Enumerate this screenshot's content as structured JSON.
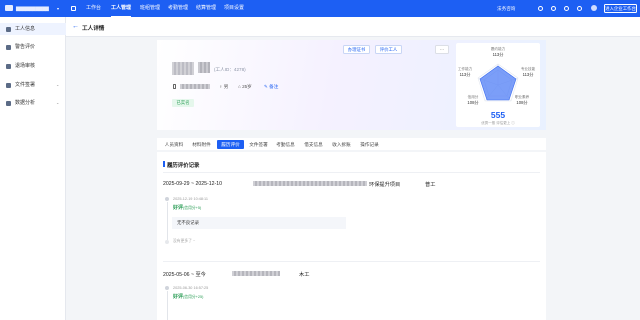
{
  "topbar": {
    "company_dropdown": "▾",
    "nav": [
      "工作台",
      "工人管理",
      "班组管理",
      "考勤管理",
      "结算管理",
      "项目设置"
    ],
    "active_nav": "工人管理",
    "right_link": "法务咨询",
    "enter_button": "进入企业工作台"
  },
  "sidebar": {
    "items": [
      {
        "label": "工人信息",
        "icon": "worker-icon",
        "active": true
      },
      {
        "label": "警告评价",
        "icon": "warning-icon"
      },
      {
        "label": "退场审核",
        "icon": "exit-review-icon"
      },
      {
        "label": "文件签署",
        "icon": "file-sign-icon",
        "chevron": "⌄"
      },
      {
        "label": "数据分析",
        "icon": "chart-icon",
        "chevron": "⌄"
      }
    ]
  },
  "header": {
    "back": "←",
    "title": "工人详情"
  },
  "profile": {
    "worker_id": "(工人ID：4278)",
    "gender": "男",
    "age": "25岁",
    "note": "备注",
    "status_tag": "已实名",
    "buttons": {
      "certificate": "办理证书",
      "evaluate": "评价工人",
      "more": "···"
    }
  },
  "radar": {
    "labels": [
      {
        "name": "履约能力",
        "value": "113分"
      },
      {
        "name": "专业技能",
        "value": "113分"
      },
      {
        "name": "工作能力",
        "value": "113分"
      },
      {
        "name": "职业素养",
        "value": "108分"
      },
      {
        "name": "信用分",
        "value": "108分"
      }
    ],
    "total": "555",
    "caption": "优秀一般 评估更上 ⓘ"
  },
  "tabs": [
    "人员资料",
    "材料附件",
    "履历评价",
    "文件签署",
    "考勤信息",
    "借支信息",
    "收入拆账",
    "操作记录"
  ],
  "active_tab": "履历评价",
  "section_title": "履历评价记录",
  "records": [
    {
      "date_range": "2025-09-29 ~ 2025-12-10",
      "project_suffix": "环保提升项目",
      "role": "普工",
      "eval_time": "2025-12-19 10:48:11",
      "rating": "好评",
      "rating_detail": "(信用分+5)",
      "comment": "无不良记录",
      "more": "没有更多了 ~"
    },
    {
      "date_range": "2025-05-06 ~ 至今",
      "role": "木工",
      "eval_time": "2025-06-30 16:57:25",
      "rating": "好评",
      "rating_detail": "(信用分+25)"
    }
  ],
  "colors": {
    "brand": "#1d5ff3",
    "success": "#2a9d55",
    "background": "#f3f5f8"
  }
}
